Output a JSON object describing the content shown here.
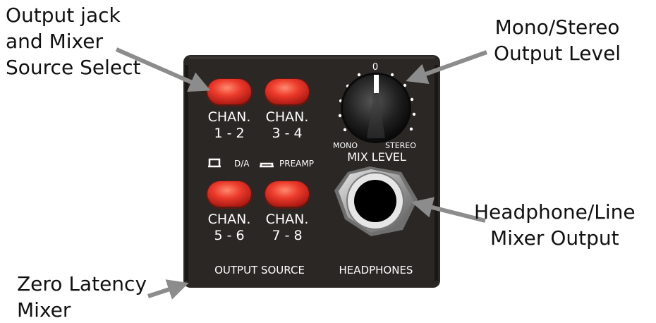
{
  "callouts": {
    "output_jack": [
      "Output jack",
      "and Mixer",
      "Source Select"
    ],
    "mono_stereo": [
      "Mono/Stereo",
      "Output Level"
    ],
    "headphone_line": [
      "Headphone/Line",
      "Mixer Output"
    ],
    "zero_latency": [
      "Zero Latency",
      "Mixer"
    ]
  },
  "panel": {
    "buttons": [
      {
        "line1": "CHAN.",
        "line2": "1 - 2"
      },
      {
        "line1": "CHAN.",
        "line2": "3 - 4"
      },
      {
        "line1": "CHAN.",
        "line2": "5 - 6"
      },
      {
        "line1": "CHAN.",
        "line2": "7 - 8"
      }
    ],
    "mode_da": "D/A",
    "mode_preamp": "PREAMP",
    "knob_zero": "0",
    "knob_mono": "MONO",
    "knob_stereo": "STEREO",
    "knob_label": "MIX LEVEL",
    "output_source_label": "OUTPUT SOURCE",
    "headphones_label": "HEADPHONES"
  },
  "colors": {
    "panel": "#2a2624",
    "button": "#e8352c",
    "text": "#ffffff",
    "arrow": "#8c8c8c"
  }
}
